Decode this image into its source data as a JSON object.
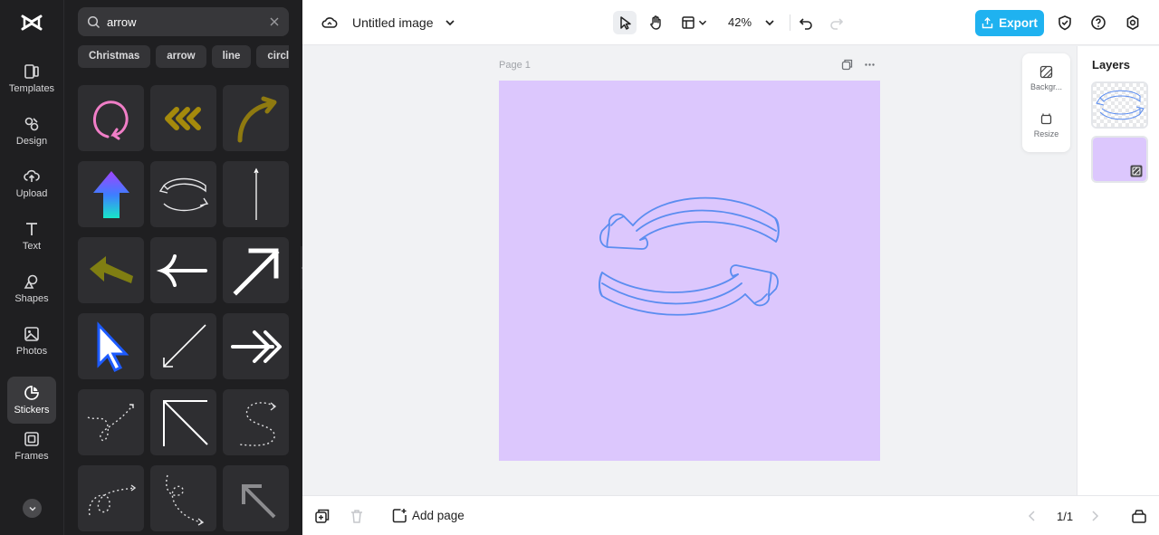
{
  "app": {
    "logo": "capcut-logo-icon"
  },
  "rail": {
    "items": [
      {
        "label": "Templates",
        "icon": "templates-icon"
      },
      {
        "label": "Design",
        "icon": "design-icon"
      },
      {
        "label": "Upload",
        "icon": "upload-icon"
      },
      {
        "label": "Text",
        "icon": "text-icon"
      },
      {
        "label": "Shapes",
        "icon": "shapes-icon"
      },
      {
        "label": "Photos",
        "icon": "photos-icon"
      },
      {
        "label": "Stickers",
        "icon": "stickers-icon",
        "active": true
      },
      {
        "label": "Frames",
        "icon": "frames-icon"
      }
    ]
  },
  "panel": {
    "search": {
      "value": "arrow",
      "icon": "search-icon"
    },
    "chips": [
      "Christmas",
      "arrow",
      "line",
      "circle"
    ],
    "stickers": [
      {
        "name": "pink-circular-arrow-sticker",
        "color": "#f07ec7"
      },
      {
        "name": "olive-chevrons-sticker",
        "color": "#a58a0c"
      },
      {
        "name": "olive-curved-arrow-sticker",
        "color": "#8f7a10"
      },
      {
        "name": "gradient-up-arrow-sticker",
        "color": "#7a5cff"
      },
      {
        "name": "outline-cycle-arrows-sticker",
        "color": "#ffffff"
      },
      {
        "name": "thin-vertical-arrow-sticker",
        "color": "#ffffff"
      },
      {
        "name": "olive-left-arrow-sticker",
        "color": "#7f7e12"
      },
      {
        "name": "white-left-arrow-sticker",
        "color": "#ffffff"
      },
      {
        "name": "white-diagonal-arrow-sticker",
        "color": "#ffffff"
      },
      {
        "name": "pixel-cursor-sticker",
        "color": "#1d5bff"
      },
      {
        "name": "thin-diagonal-arrow-sticker",
        "color": "#ffffff"
      },
      {
        "name": "double-chevron-arrow-sticker",
        "color": "#ffffff"
      },
      {
        "name": "dotted-curvy-arrow-sticker",
        "color": "#ffffff"
      },
      {
        "name": "corner-diagonal-arrow-sticker",
        "color": "#ffffff"
      },
      {
        "name": "dotted-s-arrow-sticker",
        "color": "#ffffff"
      },
      {
        "name": "dotted-loop-arrow-sticker",
        "color": "#ffffff"
      },
      {
        "name": "dotted-swirl-arrow-sticker",
        "color": "#ffffff"
      },
      {
        "name": "grey-up-left-arrow-sticker",
        "color": "#8c8c8f"
      }
    ]
  },
  "topbar": {
    "title": "Untitled image",
    "zoom": "42%",
    "export_label": "Export",
    "accent": "#1fb2f0"
  },
  "canvas": {
    "page_label": "Page 1",
    "background": "#dcc7fd",
    "sticker_stroke": "#5b8df0",
    "floating": {
      "background_label": "Backgr...",
      "resize_label": "Resize"
    }
  },
  "layers": {
    "title": "Layers"
  },
  "bottombar": {
    "add_page_label": "Add page",
    "page_count": "1/1"
  }
}
